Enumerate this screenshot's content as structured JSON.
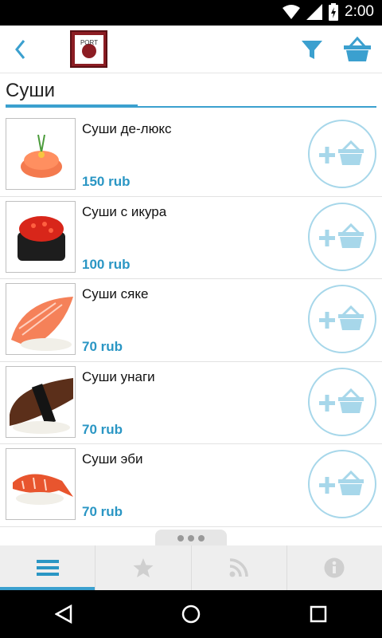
{
  "status": {
    "time": "2:00"
  },
  "header": {
    "logo_text": "PORT"
  },
  "section": {
    "title": "Суши"
  },
  "items": [
    {
      "name": "Суши де-люкс",
      "price": "150 rub"
    },
    {
      "name": "Суши с икура",
      "price": "100 rub"
    },
    {
      "name": "Суши сяке",
      "price": "70 rub"
    },
    {
      "name": "Суши унаги",
      "price": "70 rub"
    },
    {
      "name": "Суши эби",
      "price": "70 rub"
    }
  ],
  "tabs": [
    {
      "icon": "menu-icon"
    },
    {
      "icon": "star-icon"
    },
    {
      "icon": "rss-icon"
    },
    {
      "icon": "info-icon"
    }
  ],
  "colors": {
    "accent": "#3ba0cf",
    "price": "#2a96c4",
    "add_button": "#a7d7ea"
  }
}
